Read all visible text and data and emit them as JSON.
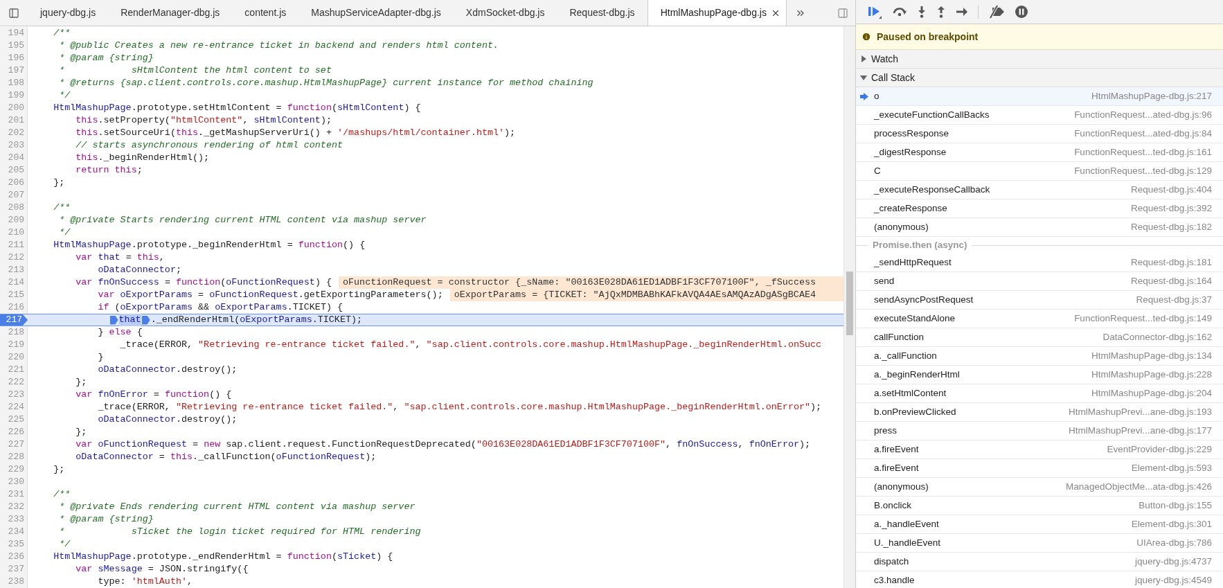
{
  "tabs": [
    {
      "label": "jquery-dbg.js",
      "selected": false
    },
    {
      "label": "RenderManager-dbg.js",
      "selected": false
    },
    {
      "label": "content.js",
      "selected": false
    },
    {
      "label": "MashupServiceAdapter-dbg.js",
      "selected": false
    },
    {
      "label": "XdmSocket-dbg.js",
      "selected": false
    },
    {
      "label": "Request-dbg.js",
      "selected": false
    },
    {
      "label": "HtmlMashupPage-dbg.js",
      "selected": true
    }
  ],
  "editor": {
    "lines": [
      {
        "number": "194",
        "current": false,
        "tokens": [
          {
            "kind": "comment",
            "text": "    /**"
          }
        ]
      },
      {
        "number": "195",
        "current": false,
        "tokens": [
          {
            "kind": "comment",
            "text": "     * @public Creates a new re-entrance ticket in backend and renders html content."
          }
        ]
      },
      {
        "number": "196",
        "current": false,
        "tokens": [
          {
            "kind": "comment",
            "text": "     * @param {string}"
          }
        ]
      },
      {
        "number": "197",
        "current": false,
        "tokens": [
          {
            "kind": "comment",
            "text": "     *            sHtmlContent the html content to set"
          }
        ]
      },
      {
        "number": "198",
        "current": false,
        "tokens": [
          {
            "kind": "comment",
            "text": "     * @returns {sap.client.controls.core.mashup.HtmlMashupPage} current instance for method chaining"
          }
        ]
      },
      {
        "number": "199",
        "current": false,
        "tokens": [
          {
            "kind": "comment",
            "text": "     */"
          }
        ]
      },
      {
        "number": "200",
        "current": false,
        "tokens": [
          {
            "kind": "name",
            "text": "    HtmlMashupPage"
          },
          {
            "kind": "plain",
            "text": ".prototype.setHtmlContent = "
          },
          {
            "kind": "keyword",
            "text": "function"
          },
          {
            "kind": "plain",
            "text": "("
          },
          {
            "kind": "name",
            "text": "sHtmlContent"
          },
          {
            "kind": "plain",
            "text": ") {"
          }
        ]
      },
      {
        "number": "201",
        "current": false,
        "tokens": [
          {
            "kind": "keyword",
            "text": "        this"
          },
          {
            "kind": "plain",
            "text": ".setProperty("
          },
          {
            "kind": "string",
            "text": "\"htmlContent\""
          },
          {
            "kind": "plain",
            "text": ", "
          },
          {
            "kind": "name",
            "text": "sHtmlContent"
          },
          {
            "kind": "plain",
            "text": ");"
          }
        ]
      },
      {
        "number": "202",
        "current": false,
        "tokens": [
          {
            "kind": "keyword",
            "text": "        this"
          },
          {
            "kind": "plain",
            "text": ".setSourceUri("
          },
          {
            "kind": "keyword",
            "text": "this"
          },
          {
            "kind": "plain",
            "text": "._getMashupServerUri() + "
          },
          {
            "kind": "string",
            "text": "'/mashups/html/container.html'"
          },
          {
            "kind": "plain",
            "text": ");"
          }
        ]
      },
      {
        "number": "203",
        "current": false,
        "tokens": [
          {
            "kind": "comment",
            "text": "        // starts asynchronous rendering of html content"
          }
        ]
      },
      {
        "number": "204",
        "current": false,
        "tokens": [
          {
            "kind": "keyword",
            "text": "        this"
          },
          {
            "kind": "plain",
            "text": "._beginRenderHtml();"
          }
        ]
      },
      {
        "number": "205",
        "current": false,
        "tokens": [
          {
            "kind": "keyword",
            "text": "        return"
          },
          {
            "kind": "keyword",
            "text": " this"
          },
          {
            "kind": "plain",
            "text": ";"
          }
        ]
      },
      {
        "number": "206",
        "current": false,
        "tokens": [
          {
            "kind": "plain",
            "text": "    };"
          }
        ]
      },
      {
        "number": "207",
        "current": false
      },
      {
        "number": "208",
        "current": false,
        "tokens": [
          {
            "kind": "comment",
            "text": "    /**"
          }
        ]
      },
      {
        "number": "209",
        "current": false,
        "tokens": [
          {
            "kind": "comment",
            "text": "     * @private Starts rendering current HTML content via mashup server"
          }
        ]
      },
      {
        "number": "210",
        "current": false,
        "tokens": [
          {
            "kind": "comment",
            "text": "     */"
          }
        ]
      },
      {
        "number": "211",
        "current": false,
        "tokens": [
          {
            "kind": "name",
            "text": "    HtmlMashupPage"
          },
          {
            "kind": "plain",
            "text": ".prototype._beginRenderHtml = "
          },
          {
            "kind": "keyword",
            "text": "function"
          },
          {
            "kind": "plain",
            "text": "() {"
          }
        ]
      },
      {
        "number": "212",
        "current": false,
        "tokens": [
          {
            "kind": "keyword",
            "text": "        var"
          },
          {
            "kind": "name",
            "text": " that"
          },
          {
            "kind": "plain",
            "text": " = "
          },
          {
            "kind": "keyword",
            "text": "this"
          },
          {
            "kind": "plain",
            "text": ","
          }
        ]
      },
      {
        "number": "213",
        "current": false,
        "tokens": [
          {
            "kind": "name",
            "text": "            oDataConnector"
          },
          {
            "kind": "plain",
            "text": ";"
          }
        ]
      },
      {
        "number": "214",
        "current": false,
        "tokens": [
          {
            "kind": "keyword",
            "text": "        var"
          },
          {
            "kind": "name",
            "text": " fnOnSuccess"
          },
          {
            "kind": "plain",
            "text": " = "
          },
          {
            "kind": "keyword",
            "text": "function"
          },
          {
            "kind": "plain",
            "text": "("
          },
          {
            "kind": "name",
            "text": "oFunctionRequest"
          },
          {
            "kind": "plain",
            "text": ") {"
          }
        ],
        "inline_value": "oFunctionRequest = constructor {_sName: \"00163E028DA61ED1ADBF1F3CF707100F\", _fSuccess"
      },
      {
        "number": "215",
        "current": false,
        "tokens": [
          {
            "kind": "keyword",
            "text": "            var"
          },
          {
            "kind": "name",
            "text": " oExportParams"
          },
          {
            "kind": "plain",
            "text": " = "
          },
          {
            "kind": "name",
            "text": "oFunctionRequest"
          },
          {
            "kind": "plain",
            "text": ".getExportingParameters();"
          }
        ],
        "inline_value": "oExportParams = {TICKET: \"AjQxMDMBABhKAFkAVQA4AEsAMQAzADgASgBCAE4"
      },
      {
        "number": "216",
        "current": false,
        "tokens": [
          {
            "kind": "keyword",
            "text": "            if"
          },
          {
            "kind": "plain",
            "text": " ("
          },
          {
            "kind": "name",
            "text": "oExportParams"
          },
          {
            "kind": "plain",
            "text": " && "
          },
          {
            "kind": "name",
            "text": "oExportParams"
          },
          {
            "kind": "plain",
            "text": ".TICKET) {"
          }
        ]
      },
      {
        "number": "217",
        "current": true,
        "tokens": [
          {
            "kind": "paused-call",
            "text": "              that"
          },
          {
            "kind": "call-marker",
            "text": "._endRenderHtml("
          },
          {
            "kind": "name",
            "text": "oExportParams"
          },
          {
            "kind": "plain",
            "text": ".TICKET);"
          }
        ]
      },
      {
        "number": "218",
        "current": false,
        "tokens": [
          {
            "kind": "plain",
            "text": "            } "
          },
          {
            "kind": "keyword",
            "text": "else"
          },
          {
            "kind": "plain",
            "text": " {"
          }
        ]
      },
      {
        "number": "219",
        "current": false,
        "tokens": [
          {
            "kind": "plain",
            "text": "                _trace(ERROR, "
          },
          {
            "kind": "string",
            "text": "\"Retrieving re-entrance ticket failed.\""
          },
          {
            "kind": "plain",
            "text": ", "
          },
          {
            "kind": "string",
            "text": "\"sap.client.controls.core.mashup.HtmlMashupPage._beginRenderHtml.onSucc"
          }
        ]
      },
      {
        "number": "220",
        "current": false,
        "tokens": [
          {
            "kind": "plain",
            "text": "            }"
          }
        ]
      },
      {
        "number": "221",
        "current": false,
        "tokens": [
          {
            "kind": "name",
            "text": "            oDataConnector"
          },
          {
            "kind": "plain",
            "text": ".destroy();"
          }
        ]
      },
      {
        "number": "222",
        "current": false,
        "tokens": [
          {
            "kind": "plain",
            "text": "        };"
          }
        ]
      },
      {
        "number": "223",
        "current": false,
        "tokens": [
          {
            "kind": "keyword",
            "text": "        var"
          },
          {
            "kind": "name",
            "text": " fnOnError"
          },
          {
            "kind": "plain",
            "text": " = "
          },
          {
            "kind": "keyword",
            "text": "function"
          },
          {
            "kind": "plain",
            "text": "() {"
          }
        ]
      },
      {
        "number": "224",
        "current": false,
        "tokens": [
          {
            "kind": "plain",
            "text": "            _trace(ERROR, "
          },
          {
            "kind": "string",
            "text": "\"Retrieving re-entrance ticket failed.\""
          },
          {
            "kind": "plain",
            "text": ", "
          },
          {
            "kind": "string",
            "text": "\"sap.client.controls.core.mashup.HtmlMashupPage._beginRenderHtml.onError\""
          },
          {
            "kind": "plain",
            "text": ");"
          }
        ]
      },
      {
        "number": "225",
        "current": false,
        "tokens": [
          {
            "kind": "name",
            "text": "            oDataConnector"
          },
          {
            "kind": "plain",
            "text": ".destroy();"
          }
        ]
      },
      {
        "number": "226",
        "current": false,
        "tokens": [
          {
            "kind": "plain",
            "text": "        };"
          }
        ]
      },
      {
        "number": "227",
        "current": false,
        "tokens": [
          {
            "kind": "keyword",
            "text": "        var"
          },
          {
            "kind": "name",
            "text": " oFunctionRequest"
          },
          {
            "kind": "plain",
            "text": " = "
          },
          {
            "kind": "keyword",
            "text": "new"
          },
          {
            "kind": "plain",
            "text": " sap.client.request.FunctionRequestDeprecated("
          },
          {
            "kind": "string",
            "text": "\"00163E028DA61ED1ADBF1F3CF707100F\""
          },
          {
            "kind": "plain",
            "text": ", "
          },
          {
            "kind": "name",
            "text": "fnOnSuccess"
          },
          {
            "kind": "plain",
            "text": ", "
          },
          {
            "kind": "name",
            "text": "fnOnError"
          },
          {
            "kind": "plain",
            "text": ");"
          }
        ]
      },
      {
        "number": "228",
        "current": false,
        "tokens": [
          {
            "kind": "name",
            "text": "        oDataConnector"
          },
          {
            "kind": "plain",
            "text": " = "
          },
          {
            "kind": "keyword",
            "text": "this"
          },
          {
            "kind": "plain",
            "text": "._callFunction("
          },
          {
            "kind": "name",
            "text": "oFunctionRequest"
          },
          {
            "kind": "plain",
            "text": ");"
          }
        ]
      },
      {
        "number": "229",
        "current": false,
        "tokens": [
          {
            "kind": "plain",
            "text": "    };"
          }
        ]
      },
      {
        "number": "230",
        "current": false
      },
      {
        "number": "231",
        "current": false,
        "tokens": [
          {
            "kind": "comment",
            "text": "    /**"
          }
        ]
      },
      {
        "number": "232",
        "current": false,
        "tokens": [
          {
            "kind": "comment",
            "text": "     * @private Ends rendering current HTML content via mashup server"
          }
        ]
      },
      {
        "number": "233",
        "current": false,
        "tokens": [
          {
            "kind": "comment",
            "text": "     * @param {string}"
          }
        ]
      },
      {
        "number": "234",
        "current": false,
        "tokens": [
          {
            "kind": "comment",
            "text": "     *            sTicket the login ticket required for HTML rendering"
          }
        ]
      },
      {
        "number": "235",
        "current": false,
        "tokens": [
          {
            "kind": "comment",
            "text": "     */"
          }
        ]
      },
      {
        "number": "236",
        "current": false,
        "tokens": [
          {
            "kind": "name",
            "text": "    HtmlMashupPage"
          },
          {
            "kind": "plain",
            "text": ".prototype._endRenderHtml = "
          },
          {
            "kind": "keyword",
            "text": "function"
          },
          {
            "kind": "plain",
            "text": "("
          },
          {
            "kind": "name",
            "text": "sTicket"
          },
          {
            "kind": "plain",
            "text": ") {"
          }
        ]
      },
      {
        "number": "237",
        "current": false,
        "tokens": [
          {
            "kind": "keyword",
            "text": "        var"
          },
          {
            "kind": "name",
            "text": " sMessage"
          },
          {
            "kind": "plain",
            "text": " = JSON.stringify({"
          }
        ]
      },
      {
        "number": "238",
        "current": false,
        "tokens": [
          {
            "kind": "plain",
            "text": "            type: "
          },
          {
            "kind": "string",
            "text": "'htmlAuth'"
          },
          {
            "kind": "plain",
            "text": ","
          }
        ]
      }
    ]
  },
  "debugger": {
    "banner": "Paused on breakpoint",
    "sections": [
      {
        "label": "Watch",
        "expanded": false
      },
      {
        "label": "Call Stack",
        "expanded": true
      }
    ],
    "call_stack": [
      {
        "kind": "frame",
        "function": "o",
        "location": "HtmlMashupPage-dbg.js:217",
        "selected": true
      },
      {
        "kind": "frame",
        "function": "_executeFunctionCallBacks",
        "location": "FunctionRequest...ated-dbg.js:96",
        "selected": false
      },
      {
        "kind": "frame",
        "function": "processResponse",
        "location": "FunctionRequest...ated-dbg.js:84",
        "selected": false
      },
      {
        "kind": "frame",
        "function": "_digestResponse",
        "location": "FunctionRequest...ted-dbg.js:161",
        "selected": false
      },
      {
        "kind": "frame",
        "function": "C",
        "location": "FunctionRequest...ted-dbg.js:129",
        "selected": false
      },
      {
        "kind": "frame",
        "function": "_executeResponseCallback",
        "location": "Request-dbg.js:404",
        "selected": false
      },
      {
        "kind": "frame",
        "function": "_createResponse",
        "location": "Request-dbg.js:392",
        "selected": false
      },
      {
        "kind": "frame",
        "function": "(anonymous)",
        "location": "Request-dbg.js:182",
        "selected": false
      },
      {
        "kind": "async",
        "function": "Promise.then (async)"
      },
      {
        "kind": "frame",
        "function": "_sendHttpRequest",
        "location": "Request-dbg.js:181",
        "selected": false
      },
      {
        "kind": "frame",
        "function": "send",
        "location": "Request-dbg.js:164",
        "selected": false
      },
      {
        "kind": "frame",
        "function": "sendAsyncPostRequest",
        "location": "Request-dbg.js:37",
        "selected": false
      },
      {
        "kind": "frame",
        "function": "executeStandAlone",
        "location": "FunctionRequest...ted-dbg.js:149",
        "selected": false
      },
      {
        "kind": "frame",
        "function": "callFunction",
        "location": "DataConnector-dbg.js:162",
        "selected": false
      },
      {
        "kind": "frame",
        "function": "a._callFunction",
        "location": "HtmlMashupPage-dbg.js:134",
        "selected": false
      },
      {
        "kind": "frame",
        "function": "a._beginRenderHtml",
        "location": "HtmlMashupPage-dbg.js:228",
        "selected": false
      },
      {
        "kind": "frame",
        "function": "a.setHtmlContent",
        "location": "HtmlMashupPage-dbg.js:204",
        "selected": false
      },
      {
        "kind": "frame",
        "function": "b.onPreviewClicked",
        "location": "HtmlMashupPrevi...ane-dbg.js:193",
        "selected": false
      },
      {
        "kind": "frame",
        "function": "press",
        "location": "HtmlMashupPrevi...ane-dbg.js:177",
        "selected": false
      },
      {
        "kind": "frame",
        "function": "a.fireEvent",
        "location": "EventProvider-dbg.js:229",
        "selected": false
      },
      {
        "kind": "frame",
        "function": "a.fireEvent",
        "location": "Element-dbg.js:593",
        "selected": false
      },
      {
        "kind": "frame",
        "function": "(anonymous)",
        "location": "ManagedObjectMe...ata-dbg.js:426",
        "selected": false
      },
      {
        "kind": "frame",
        "function": "B.onclick",
        "location": "Button-dbg.js:155",
        "selected": false
      },
      {
        "kind": "frame",
        "function": "a._handleEvent",
        "location": "Element-dbg.js:301",
        "selected": false
      },
      {
        "kind": "frame",
        "function": "U._handleEvent",
        "location": "UIArea-dbg.js:786",
        "selected": false
      },
      {
        "kind": "frame",
        "function": "dispatch",
        "location": "jquery-dbg.js:4737",
        "selected": false
      },
      {
        "kind": "frame",
        "function": "c3.handle",
        "location": "jquery-dbg.js:4549",
        "selected": false
      }
    ]
  }
}
